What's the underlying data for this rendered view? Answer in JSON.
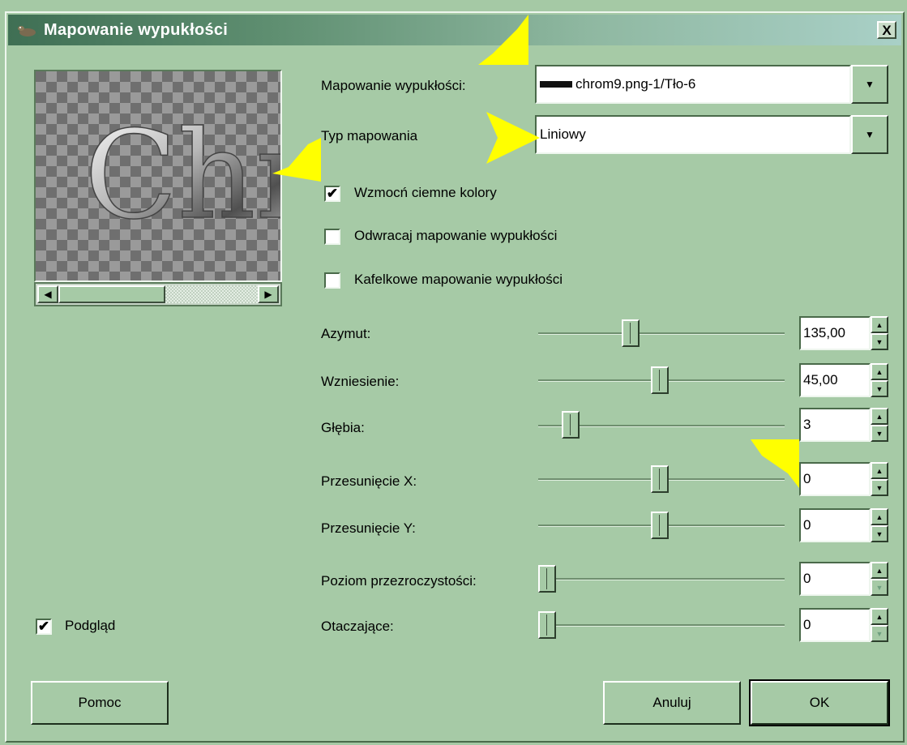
{
  "window": {
    "title": "Mapowanie wypukłości",
    "close_label": "X"
  },
  "preview": {
    "text": "Chr",
    "checkbox_label": "Podgląd",
    "checked": true
  },
  "bumpmap": {
    "label": "Mapowanie wypukłości:",
    "value": "chrom9.png-1/Tło-6"
  },
  "map_type": {
    "label": "Typ mapowania",
    "value": "Liniowy"
  },
  "options": [
    {
      "label": "Wzmocń ciemne kolory",
      "checked": true
    },
    {
      "label": "Odwracaj mapowanie wypukłości",
      "checked": false
    },
    {
      "label": "Kafelkowe mapowanie wypukłości",
      "checked": false
    }
  ],
  "sliders": [
    {
      "label": "Azymut:",
      "value": "135,00",
      "pos": 0.375
    },
    {
      "label": "Wzniesienie:",
      "value": "45,00",
      "pos": 0.5
    },
    {
      "label": "Głębia:",
      "value": "3",
      "pos": 0.06
    },
    {
      "label": "Przesunięcie X:",
      "value": "0",
      "pos": 0.5
    },
    {
      "label": "Przesunięcie Y:",
      "value": "0",
      "pos": 0.5
    },
    {
      "label": "Poziom przezroczystości:",
      "value": "0",
      "pos": 0.0
    },
    {
      "label": "Otaczające:",
      "value": "0",
      "pos": 0.0
    }
  ],
  "buttons": {
    "help": "Pomoc",
    "cancel": "Anuluj",
    "ok": "OK"
  },
  "colors": {
    "title_start": "#3f6f54",
    "background": "#a6caa6",
    "arrow": "#ffff00"
  }
}
